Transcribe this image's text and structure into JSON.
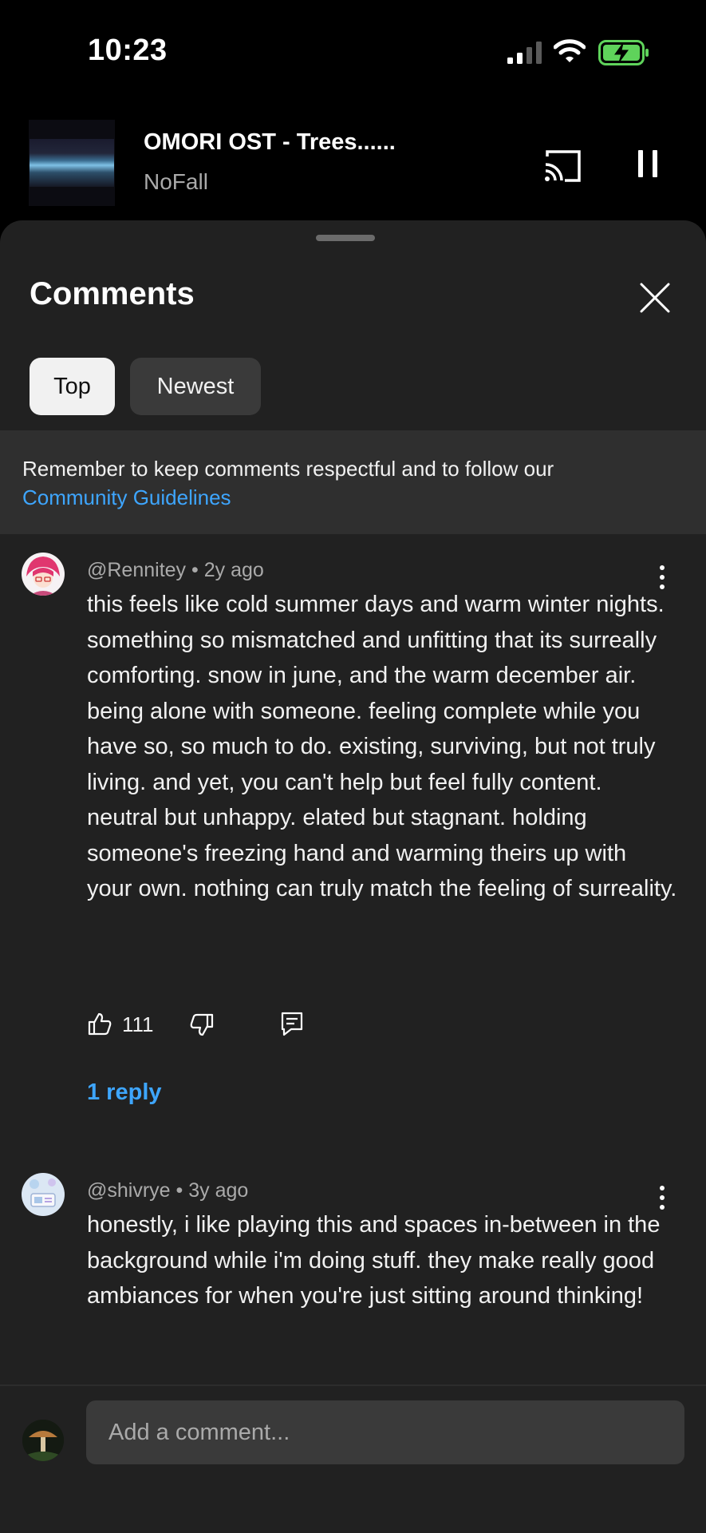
{
  "status_bar": {
    "time": "10:23"
  },
  "mini_player": {
    "title": "OMORI OST - Trees......",
    "channel": "NoFall"
  },
  "sheet": {
    "title": "Comments",
    "sort_chips": [
      {
        "label": "Top",
        "selected": true
      },
      {
        "label": "Newest",
        "selected": false
      }
    ],
    "notice": {
      "text": "Remember to keep comments respectful and to follow our",
      "link": "Community Guidelines"
    }
  },
  "comments": [
    {
      "author": "@Rennitey",
      "age": "2y ago",
      "text": "this feels like cold summer days and warm winter nights. something so mismatched and unfitting that its surreally comforting. snow in june, and the warm december air. being alone with someone. feeling complete while you have so, so much to do. existing, surviving, but not truly living. and yet, you can't help but feel fully content. neutral but unhappy. elated but stagnant. holding someone's freezing hand and warming theirs up with your own. nothing can truly match the feeling of surreality.",
      "likes": "111",
      "replies_label": "1 reply"
    },
    {
      "author": "@shivrye",
      "age": "3y ago",
      "text": "honestly, i like playing this and spaces in-between in the background while i'm doing stuff. they make really good ambiances for when you're just sitting around thinking!"
    }
  ],
  "composer": {
    "placeholder": "Add a comment..."
  },
  "colors": {
    "link": "#3ea6ff",
    "sheet_bg": "#212121",
    "notice_bg": "#2f2f2f",
    "chip_selected_bg": "#f1f1f1",
    "chip_bg": "#3a3a3a"
  },
  "icons": [
    "signal-icon",
    "wifi-icon",
    "battery-charging-icon",
    "cast-icon",
    "pause-icon",
    "close-icon",
    "more-vert-icon",
    "thumbs-up-icon",
    "thumbs-down-icon",
    "reply-icon"
  ]
}
